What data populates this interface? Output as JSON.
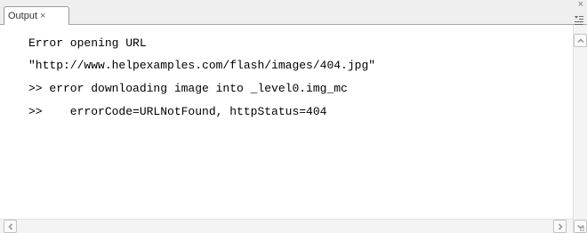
{
  "tab": {
    "label": "Output",
    "close_glyph": "×"
  },
  "window": {
    "close_glyph": "×"
  },
  "output": {
    "lines": [
      "Error opening URL",
      "\"http://www.helpexamples.com/flash/images/404.jpg\"",
      ">> error downloading image into _level0.img_mc",
      ">>    errorCode=URLNotFound, httpStatus=404"
    ]
  },
  "icons": {
    "panel_menu": "panel-menu-icon",
    "scroll_up": "chevron-up-icon",
    "scroll_down": "chevron-down-icon",
    "scroll_left": "chevron-left-icon",
    "scroll_right": "chevron-right-icon",
    "resize": "resize-grip-icon"
  }
}
